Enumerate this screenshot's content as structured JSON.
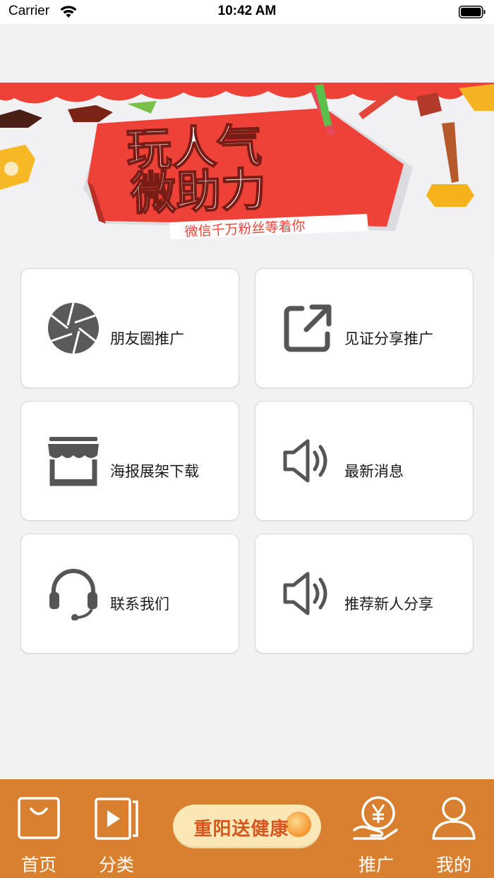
{
  "status_bar": {
    "carrier": "Carrier",
    "time": "10:42 AM"
  },
  "banner": {
    "title_line1": "玩人气",
    "title_line2": "微助力",
    "subtitle": "微信千万粉丝等着你"
  },
  "menu": {
    "items": [
      {
        "label": "朋友圈推广",
        "icon": "camera-aperture-icon"
      },
      {
        "label": "见证分享推广",
        "icon": "share-external-icon"
      },
      {
        "label": "海报展架下载",
        "icon": "storefront-icon"
      },
      {
        "label": "最新消息",
        "icon": "speaker-icon"
      },
      {
        "label": "联系我们",
        "icon": "headset-icon"
      },
      {
        "label": "推荐新人分享",
        "icon": "speaker-icon"
      }
    ]
  },
  "tabbar": {
    "home": "首页",
    "category": "分类",
    "promo": "重阳送健康",
    "promote": "推广",
    "mine": "我的"
  },
  "colors": {
    "tabbar_bg": "#d8802f",
    "banner_red": "#ee4238",
    "icon_gray": "#555555"
  }
}
